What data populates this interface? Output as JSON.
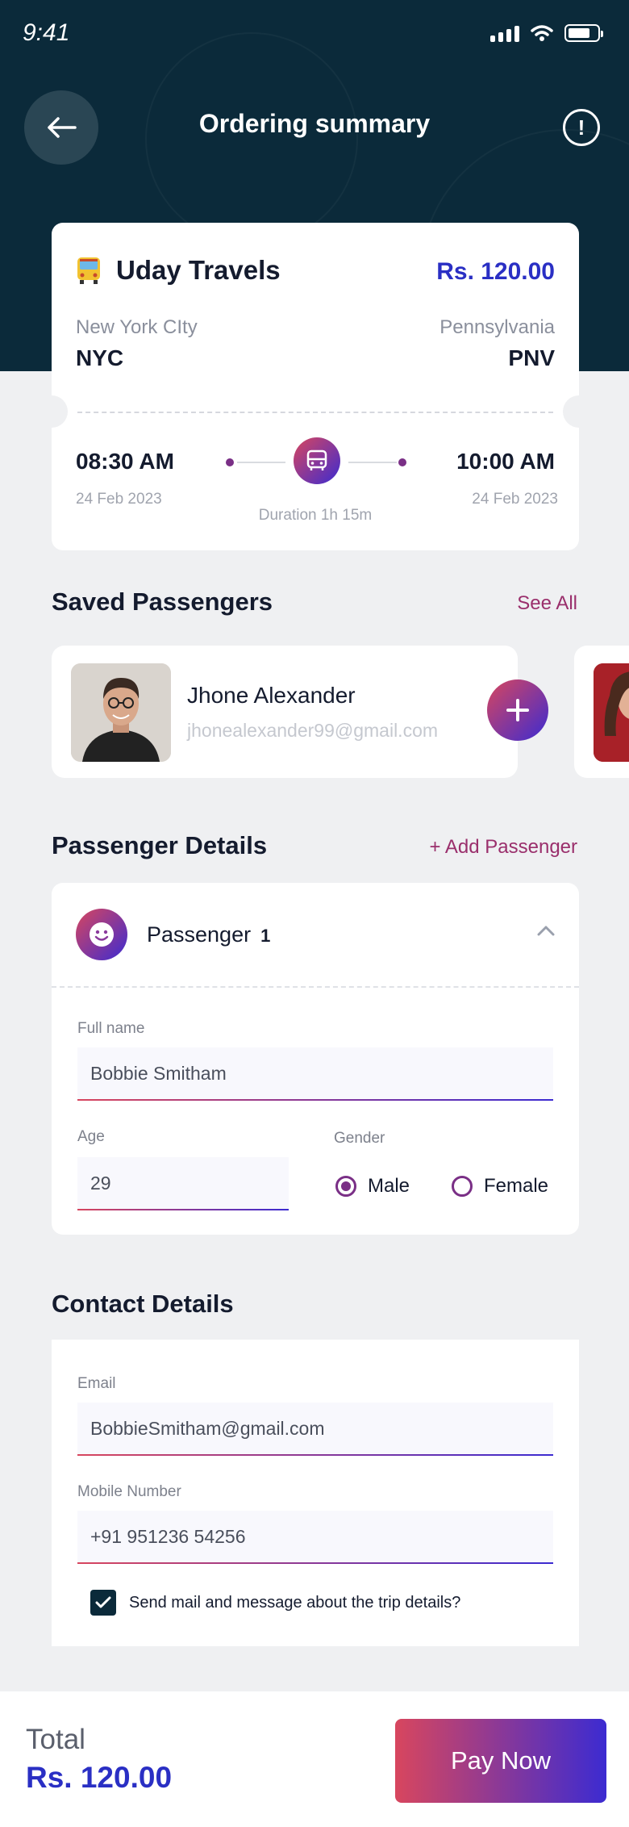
{
  "status_bar": {
    "time": "9:41"
  },
  "header": {
    "title": "Ordering summary"
  },
  "trip": {
    "company": "Uday Travels",
    "price": "Rs. 120.00",
    "from_city": "New York CIty",
    "from_code": "NYC",
    "to_city": "Pennsylvania",
    "to_code": "PNV",
    "depart_time": "08:30 AM",
    "depart_date": "24 Feb 2023",
    "arrive_time": "10:00 AM",
    "arrive_date": "24 Feb 2023",
    "duration": "Duration 1h 15m"
  },
  "saved_passengers": {
    "title": "Saved Passengers",
    "see_all": "See All",
    "items": [
      {
        "name": "Jhone Alexander",
        "email": "jhonealexander99@gmail.com"
      }
    ]
  },
  "passenger_details": {
    "title": "Passenger Details",
    "add_link": "+ Add Passenger",
    "passenger_label": "Passenger",
    "passenger_number": "1",
    "full_name_label": "Full name",
    "full_name_value": "Bobbie Smitham",
    "age_label": "Age",
    "age_value": "29",
    "gender_label": "Gender",
    "gender_options": [
      "Male",
      "Female"
    ],
    "gender_selected": "Male"
  },
  "contact_details": {
    "title": "Contact Details",
    "email_label": "Email",
    "email_value": "BobbieSmitham@gmail.com",
    "mobile_label": "Mobile Number",
    "mobile_value": "+91 951236 54256",
    "consent_text": "Send mail and message about the trip details?",
    "consent_checked": true
  },
  "footer": {
    "total_label": "Total",
    "total_value": "Rs. 120.00",
    "pay_label": "Pay Now"
  },
  "colors": {
    "header_bg": "#0b2a3a",
    "accent_blue": "#2a2fc4",
    "gradient_start": "#d8465e",
    "gradient_end": "#3c2bd1",
    "link": "#9a2f6c"
  }
}
